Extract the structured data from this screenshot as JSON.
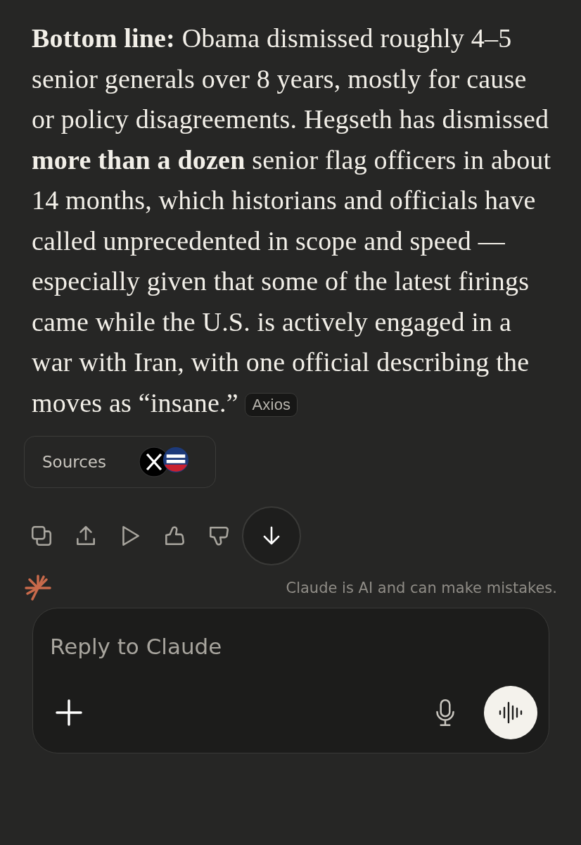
{
  "message": {
    "paragraph": "**Bottom line:** Obama dismissed roughly 4–5 senior generals over 8 years, mostly for cause or policy disagreements. Hegseth has dismissed **more than a dozen** senior flag officers in about 14 months, which historians and officials have called unprecedented in scope and speed — especially given that some of the latest firings came while the U.S. is actively engaged in a war with Iran, with one official describing the moves as “insane.”",
    "citation": "Axios"
  },
  "sources": {
    "label": "Sources"
  },
  "disclaimer": "Claude is AI and can make mistakes.",
  "composer": {
    "placeholder": "Reply to Claude"
  }
}
